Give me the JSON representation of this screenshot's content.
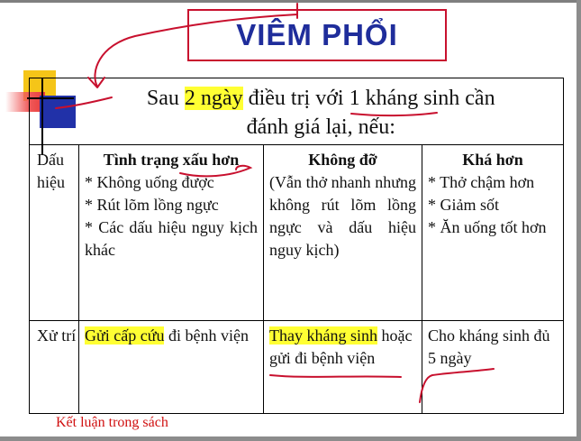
{
  "slide": {
    "title": "VIÊM PHỔI",
    "header_line1_prefix": "Sau ",
    "header_line1_highlight": "2 ngày",
    "header_line1_mid": " điều trị với ",
    "header_line1_underlined": "1 kháng",
    "header_line1_suffix": " sinh cần",
    "header_line2": "đánh giá lại, nếu:"
  },
  "table": {
    "row_label_signs": "Dấu hiệu",
    "row_label_action": "Xử trí",
    "worse": {
      "heading": "Tình trạng xấu hơn",
      "items": [
        "* Không uống được",
        "* Rút lõm lồng ngực",
        "* Các dấu hiệu nguy kịch khác"
      ],
      "action_highlight": "Gửi cấp cứu",
      "action_rest": " đi bệnh viện"
    },
    "same": {
      "heading": "Không đỡ",
      "body": "(Vẫn thở nhanh nhưng không rút lõm lồng ngực và dấu hiệu nguy kịch)",
      "action_highlight": "Thay kháng sinh",
      "action_rest": " hoặc gửi đi bệnh viện"
    },
    "better": {
      "heading": "Khá hơn",
      "items": [
        "* Thở chậm hơn",
        "* Giảm sốt",
        "* Ăn uống tốt hơn"
      ],
      "action": "Cho kháng sinh đủ 5 ngày"
    }
  },
  "note": "Kết luận trong sách",
  "colors": {
    "title_text": "#1f2d9b",
    "title_border": "#c8102e",
    "highlight": "#ffff33",
    "annotation_red": "#c8102e",
    "note_text": "#d01010"
  }
}
